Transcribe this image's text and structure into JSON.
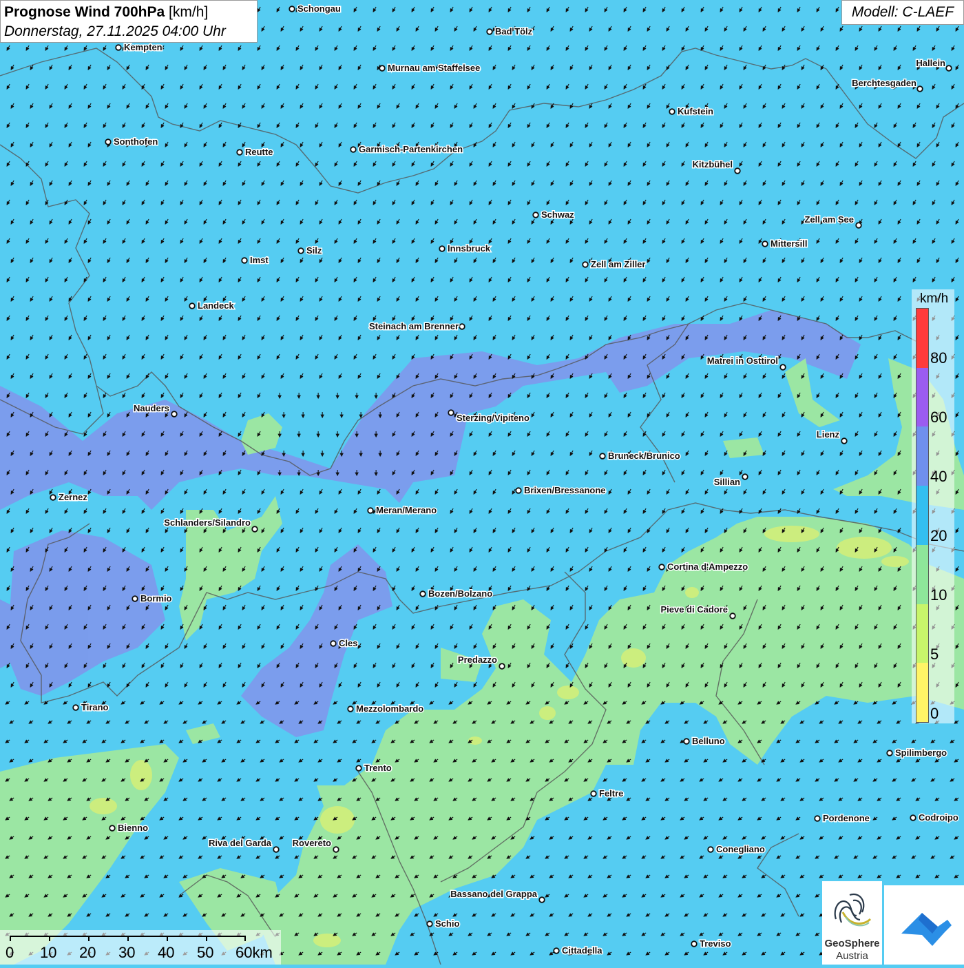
{
  "title": {
    "main": "Prognose Wind 700hPa",
    "unit": "[km/h]",
    "datetime": "Donnerstag, 27.11.2025 04:00 Uhr"
  },
  "model": "Modell: C-LAEF",
  "legend": {
    "unit": "km/h",
    "ticks": [
      "80",
      "60",
      "40",
      "20",
      "10",
      "5",
      "0"
    ],
    "colors": [
      "#ff3b3b",
      "#9b5cf0",
      "#6f90ee",
      "#33bff0",
      "#8ee69a",
      "#c8f56a",
      "#fff466"
    ]
  },
  "scalebar": {
    "labels": [
      "0",
      "10",
      "20",
      "30",
      "40",
      "50",
      "60km"
    ]
  },
  "logo": {
    "line1": "GeoSphere",
    "line2": "Austria"
  },
  "cities": [
    {
      "name": "Schongau"
    },
    {
      "name": "Bad Tölz"
    },
    {
      "name": "Kempten"
    },
    {
      "name": "Murnau am Staffelsee"
    },
    {
      "name": "Hallein"
    },
    {
      "name": "Berchtesgaden"
    },
    {
      "name": "Kufstein"
    },
    {
      "name": "Sonthofen"
    },
    {
      "name": "Reutte"
    },
    {
      "name": "Garmisch-Partenkirchen"
    },
    {
      "name": "Kitzbühel"
    },
    {
      "name": "Schwaz"
    },
    {
      "name": "Zell am See"
    },
    {
      "name": "Mittersill"
    },
    {
      "name": "Imst"
    },
    {
      "name": "Silz"
    },
    {
      "name": "Innsbruck"
    },
    {
      "name": "Zell am Ziller"
    },
    {
      "name": "Landeck"
    },
    {
      "name": "Steinach am Brenner"
    },
    {
      "name": "Matrei in Osttirol"
    },
    {
      "name": "Nauders"
    },
    {
      "name": "Sterzing/Vipiteno"
    },
    {
      "name": "Lienz"
    },
    {
      "name": "Bruneck/Brunico"
    },
    {
      "name": "Sillian"
    },
    {
      "name": "Zernez"
    },
    {
      "name": "Brixen/Bressanone"
    },
    {
      "name": "Meran/Merano"
    },
    {
      "name": "Schlanders/Silandro"
    },
    {
      "name": "Cortina d'Ampezzo"
    },
    {
      "name": "Bozen/Bolzano"
    },
    {
      "name": "Bormio"
    },
    {
      "name": "Pieve di Cadore"
    },
    {
      "name": "Cles"
    },
    {
      "name": "Predazzo"
    },
    {
      "name": "Tirano"
    },
    {
      "name": "Mezzolombardo"
    },
    {
      "name": "Belluno"
    },
    {
      "name": "Spilimbergo"
    },
    {
      "name": "Trento"
    },
    {
      "name": "Feltre"
    },
    {
      "name": "Pordenone"
    },
    {
      "name": "Codroipo"
    },
    {
      "name": "Bienno"
    },
    {
      "name": "Riva del Garda"
    },
    {
      "name": "Rovereto"
    },
    {
      "name": "Conegliano"
    },
    {
      "name": "Bassano del Grappa"
    },
    {
      "name": "Schio"
    },
    {
      "name": "Treviso"
    },
    {
      "name": "Cittadella"
    }
  ]
}
